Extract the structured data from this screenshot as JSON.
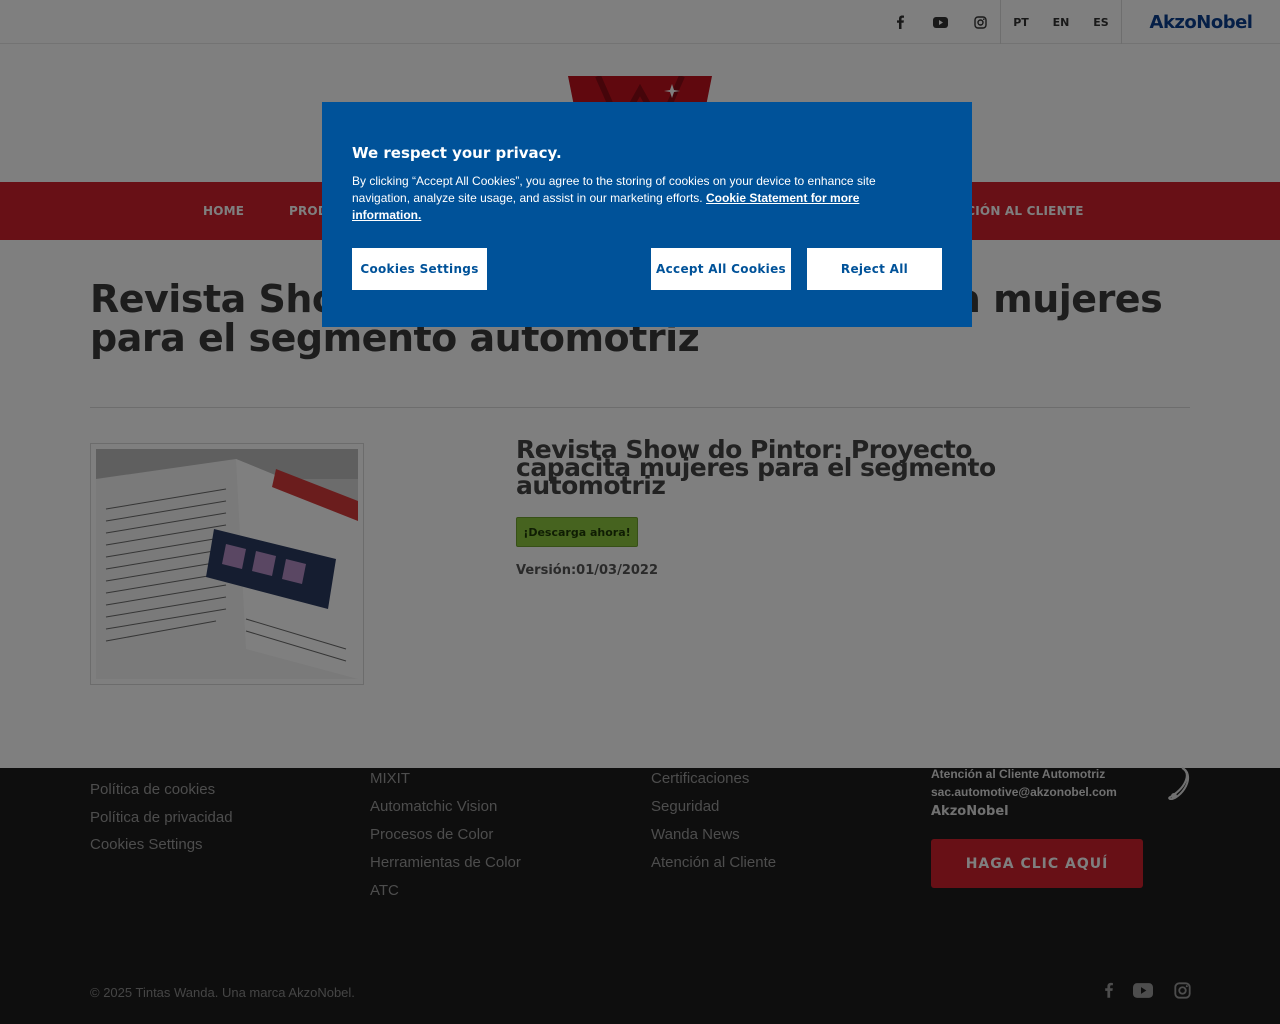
{
  "topbar": {
    "social_icons": [
      "facebook-icon",
      "youtube-icon",
      "instagram-icon"
    ],
    "languages": [
      "PT",
      "EN",
      "ES"
    ],
    "brand": "AkzoNobel"
  },
  "nav": {
    "items": [
      "HOME",
      "PROD",
      "NCIÓN AL CLIENTE"
    ]
  },
  "main": {
    "title": "Revista Show do Pintor: Proyecto capacita mujeres para el segmento automotriz",
    "doc_title": "Revista Show do Pintor: Proyecto capacita mujeres para el segmento automotriz",
    "download_label": "¡Descarga ahora!",
    "version": "Versión:01/03/2022"
  },
  "footer": {
    "col1": [
      "Política de cookies",
      "Política de privacidad",
      "Cookies Settings"
    ],
    "col2": [
      "MIXIT",
      "Automatchic Vision",
      "Procesos de Color",
      "Herramientas de Color",
      "ATC"
    ],
    "col3": [
      "Certificaciones",
      "Seguridad",
      "Wanda News",
      "Atención al Cliente"
    ],
    "contact_title": "Atención al Cliente Automotriz",
    "contact_email": "sac.automotive@akzonobel.com",
    "contact_brand": "AkzoNobel",
    "cta_label": "HAGA CLIC AQUÍ",
    "copyright": "© 2025 Tintas Wanda. Una marca AkzoNobel."
  },
  "cookie": {
    "title": "We respect your privacy.",
    "text": "By clicking “Accept All Cookies”, you agree to the storing of cookies on your device to enhance site navigation, analyze site usage, and assist in our marketing efforts.",
    "link": "Cookie Statement for more information.",
    "settings_label": "Cookies Settings",
    "accept_label": "Accept All Cookies",
    "reject_label": "Reject All"
  },
  "colors": {
    "nav_red": "#d0202c",
    "cookie_blue": "#005299",
    "download_green": "#8dc63f",
    "footer_bg": "#1c1c1c",
    "brand_blue": "#0b3f8f"
  }
}
